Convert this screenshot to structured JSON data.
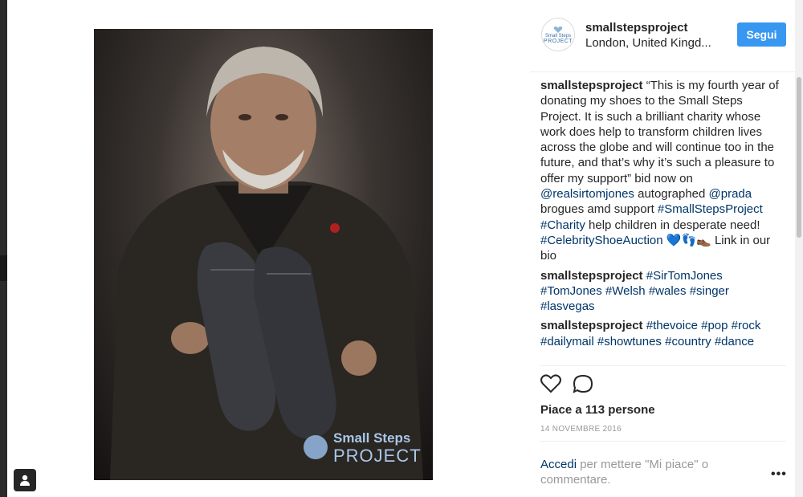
{
  "post": {
    "username": "smallstepsproject",
    "location": "London, United Kingd...",
    "follow_label": "Segui",
    "avatar_logo_top": "Small Steps",
    "avatar_logo_bottom": "PROJECT"
  },
  "photo": {
    "watermark_top": "Small Steps",
    "watermark_bottom": "PROJECT"
  },
  "comments": [
    {
      "user": "smallstepsproject",
      "parts": [
        {
          "t": "text",
          "v": " “This is my fourth year of donating my shoes to the Small Steps Project. It is such a brilliant charity whose work does help to transform children lives across the globe and will continue too in the future, and that’s why it’s such a pleasure to offer my support” bid now on "
        },
        {
          "t": "link",
          "v": "@realsirtomjones"
        },
        {
          "t": "text",
          "v": " autographed "
        },
        {
          "t": "link",
          "v": "@prada"
        },
        {
          "t": "text",
          "v": " brogues amd support "
        },
        {
          "t": "link",
          "v": "#SmallStepsProject"
        },
        {
          "t": "text",
          "v": " "
        },
        {
          "t": "link",
          "v": "#Charity"
        },
        {
          "t": "text",
          "v": " help children in desperate need! "
        },
        {
          "t": "link",
          "v": "#CelebrityShoeAuction"
        },
        {
          "t": "text",
          "v": " 💙👣👞 Link in our bio"
        }
      ]
    },
    {
      "user": "smallstepsproject",
      "parts": [
        {
          "t": "text",
          "v": " "
        },
        {
          "t": "link",
          "v": "#SirTomJones"
        },
        {
          "t": "text",
          "v": " "
        },
        {
          "t": "link",
          "v": "#TomJones"
        },
        {
          "t": "text",
          "v": " "
        },
        {
          "t": "link",
          "v": "#Welsh"
        },
        {
          "t": "text",
          "v": " "
        },
        {
          "t": "link",
          "v": "#wales"
        },
        {
          "t": "text",
          "v": " "
        },
        {
          "t": "link",
          "v": "#singer"
        },
        {
          "t": "text",
          "v": " "
        },
        {
          "t": "link",
          "v": "#lasvegas"
        }
      ]
    },
    {
      "user": "smallstepsproject",
      "parts": [
        {
          "t": "text",
          "v": " "
        },
        {
          "t": "link",
          "v": "#thevoice"
        },
        {
          "t": "text",
          "v": " "
        },
        {
          "t": "link",
          "v": "#pop"
        },
        {
          "t": "text",
          "v": " "
        },
        {
          "t": "link",
          "v": "#rock"
        },
        {
          "t": "text",
          "v": " "
        },
        {
          "t": "link",
          "v": "#dailymail"
        },
        {
          "t": "text",
          "v": " "
        },
        {
          "t": "link",
          "v": "#showtunes"
        },
        {
          "t": "text",
          "v": " "
        },
        {
          "t": "link",
          "v": "#country"
        },
        {
          "t": "text",
          "v": " "
        },
        {
          "t": "link",
          "v": "#dance"
        }
      ]
    }
  ],
  "actions": {
    "like_icon": "heart-icon",
    "comment_icon": "comment-icon",
    "likes_text": "Piace a 113 persone",
    "date_text": "14 NOVEMBRE 2016"
  },
  "footer": {
    "login_link": "Accedi",
    "login_rest": " per mettere \"Mi piace\" o commentare.",
    "more_label": "•••"
  },
  "colors": {
    "follow_button": "#3897f0",
    "link": "#003569",
    "muted": "#999999"
  }
}
